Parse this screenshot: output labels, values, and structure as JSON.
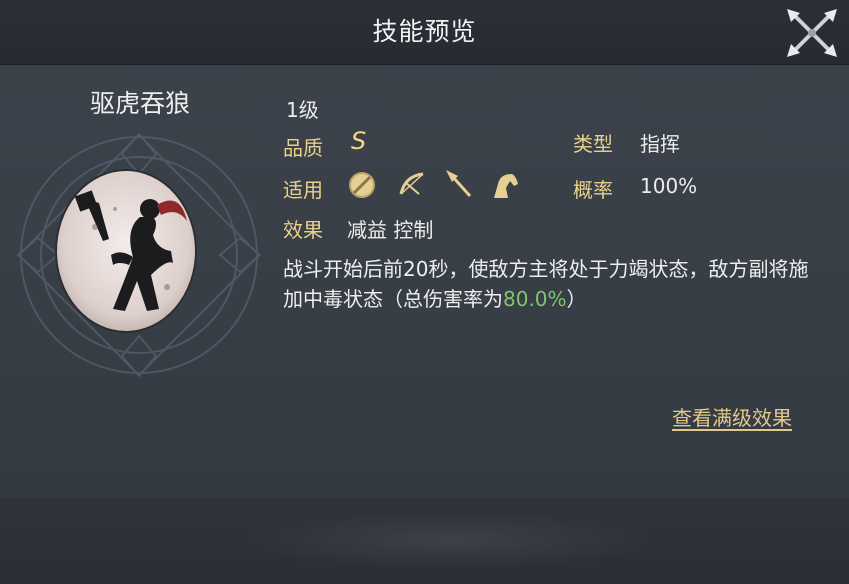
{
  "window": {
    "title": "技能预览"
  },
  "skill": {
    "name": "驱虎吞狼",
    "level": "1级",
    "quality_label": "品质",
    "quality_value": "S",
    "type_label": "类型",
    "type_value": "指挥",
    "applicable_label": "适用",
    "applicable_icons": [
      "shield-troop-icon",
      "bow-troop-icon",
      "spear-troop-icon",
      "cavalry-horse-icon"
    ],
    "rate_label": "概率",
    "rate_value": "100%",
    "effect_label": "效果",
    "effect_value": "减益 控制",
    "description_part1": "战斗开始后前20秒，使敌方主将处于力竭状态，敌方副将施加中毒状态（总伤害率为",
    "description_highlight": "80.0%",
    "description_part2": "）"
  },
  "actions": {
    "view_full_effect": "查看满级效果"
  },
  "colors": {
    "accent_gold": "#e9d18c",
    "highlight_green": "#7fc56a",
    "background": "#3a4048"
  }
}
